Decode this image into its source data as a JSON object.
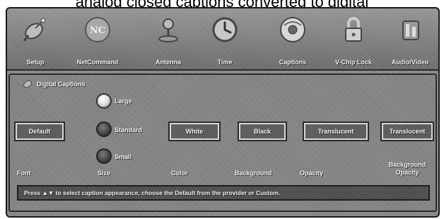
{
  "page": {
    "heading": "analog closed captions converted to digital"
  },
  "menubar": {
    "items": [
      {
        "label": "Setup",
        "icon": "satellite-dish-icon"
      },
      {
        "label": "NetCommand",
        "icon": "netcommand-logo-icon"
      },
      {
        "label": "Antenna",
        "icon": "antenna-icon"
      },
      {
        "label": "Time",
        "icon": "clock-icon"
      },
      {
        "label": "Captions",
        "icon": "captions-disc-icon"
      },
      {
        "label": "V-Chip Lock",
        "icon": "padlock-icon"
      },
      {
        "label": "Audio/Video",
        "icon": "audio-video-icon"
      }
    ]
  },
  "panel": {
    "title": "Digital Captions",
    "title_icon": "captions-small-icon",
    "font": {
      "label": "Font",
      "value": "Default"
    },
    "size": {
      "label": "Size",
      "options": [
        "Large",
        "Standard",
        "Small"
      ],
      "selected": "Large"
    },
    "color": {
      "label": "Color",
      "value": "White"
    },
    "background": {
      "label": "Background",
      "value": "Black"
    },
    "opacity": {
      "label": "Opacity",
      "value": "Translucent"
    },
    "background_opacity": {
      "label": "Background Opacity",
      "value": "Translucent"
    },
    "help_text": "Press ▲▼ to select caption appearance, choose the Default from the provider or Custom."
  },
  "colors": {
    "panel_gray": "#858585",
    "box_dark": "#5d5d5d",
    "text_light": "#f0f0f0"
  }
}
